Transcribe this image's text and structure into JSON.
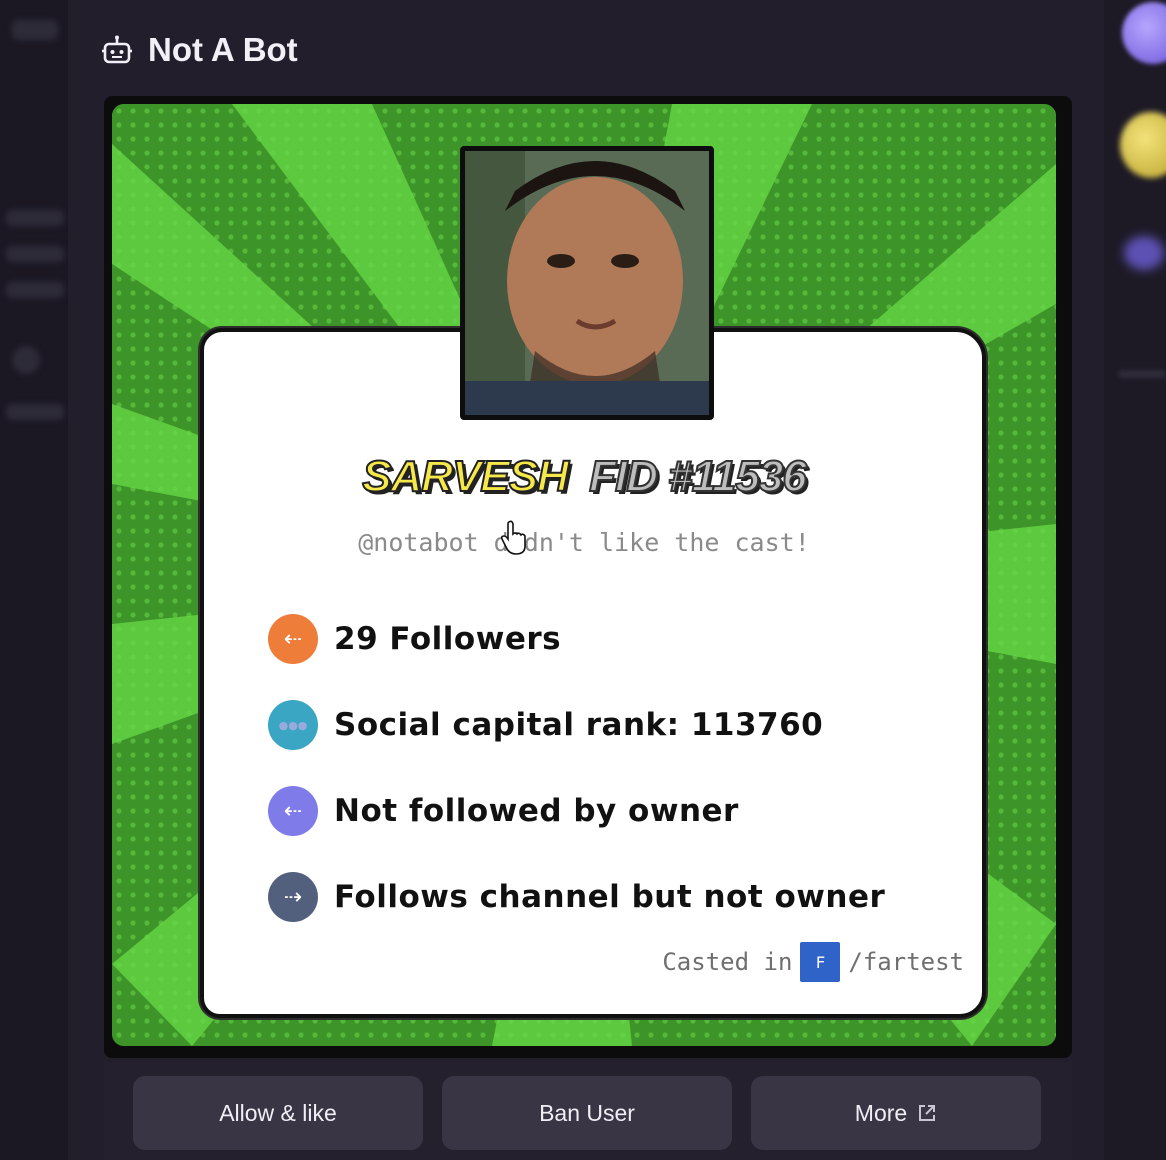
{
  "header": {
    "title": "Not A Bot",
    "icon": "bot-icon"
  },
  "card": {
    "name": "SARVESH",
    "fid": "FID #11536",
    "subtitle": "@notabot didn't like the cast!",
    "stats": [
      {
        "icon": "followers-icon",
        "color": "#ee7d3a",
        "text": "29 Followers"
      },
      {
        "icon": "social-capital-icon",
        "color": "#3aa6c4",
        "text": "Social capital rank: 113760"
      },
      {
        "icon": "not-followed-icon",
        "color": "#7f7be8",
        "text": "Not followed by owner"
      },
      {
        "icon": "follows-channel-icon",
        "color": "#52607e",
        "text": "Follows channel but not owner"
      }
    ],
    "casted_label": "Casted in",
    "channel": "/fartest",
    "channel_icon_text": "F"
  },
  "actions": {
    "allow_like": "Allow & like",
    "ban_user": "Ban User",
    "more": "More"
  },
  "colors": {
    "background": "#17141f",
    "card_green": "#3f9a2a",
    "button_bg": "#3a3545",
    "name_yellow": "#f6e84a"
  }
}
